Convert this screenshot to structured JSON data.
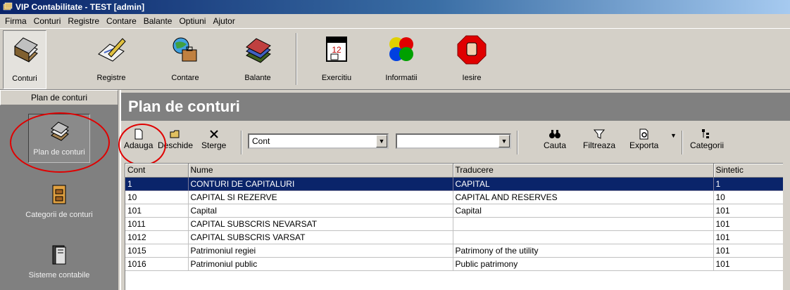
{
  "window": {
    "title": "VIP Contabilitate - TEST [admin]"
  },
  "menu": [
    "Firma",
    "Conturi",
    "Registre",
    "Contare",
    "Balante",
    "Optiuni",
    "Ajutor"
  ],
  "toolbar": {
    "items": [
      {
        "label": "Conturi",
        "icon": "books-icon"
      },
      {
        "label": "Registre",
        "icon": "pencil-icon"
      },
      {
        "label": "Contare",
        "icon": "globe-bag-icon"
      },
      {
        "label": "Balante",
        "icon": "books-stack-icon"
      },
      {
        "label": "Exercitiu",
        "icon": "calendar-icon"
      },
      {
        "label": "Informatii",
        "icon": "colored-circles-icon"
      },
      {
        "label": "Iesire",
        "icon": "stop-hand-icon"
      }
    ]
  },
  "left_panel": {
    "header": "Plan de conturi",
    "items": [
      {
        "label": "Plan de conturi",
        "icon": "books-icon"
      },
      {
        "label": "Categorii de conturi",
        "icon": "archive-icon"
      },
      {
        "label": "Sisteme contabile",
        "icon": "binder-icon"
      }
    ]
  },
  "main": {
    "title": "Plan de conturi",
    "actions": {
      "add": "Adauga",
      "open": "Deschide",
      "delete": "Sterge",
      "search": "Cauta",
      "filter": "Filtreaza",
      "export": "Exporta",
      "categories": "Categorii"
    },
    "field_select": "Cont",
    "value_select": ""
  },
  "table": {
    "columns": [
      "Cont",
      "Nume",
      "Traducere",
      "Sintetic"
    ],
    "rows": [
      [
        "1",
        "CONTURI DE CAPITALURI",
        "CAPITAL",
        "1"
      ],
      [
        "10",
        "CAPITAL SI REZERVE",
        "CAPITAL AND RESERVES",
        "10"
      ],
      [
        "101",
        "Capital",
        "Capital",
        "101"
      ],
      [
        "1011",
        "CAPITAL SUBSCRIS NEVARSAT",
        "",
        "101"
      ],
      [
        "1012",
        "CAPITAL SUBSCRIS VARSAT",
        "",
        "101"
      ],
      [
        "1015",
        "Patrimoniul regiei",
        "Patrimony of the utility",
        "101"
      ],
      [
        "1016",
        "Patrimoniul public",
        "Public patrimony",
        "101"
      ]
    ],
    "selected_row": 0
  },
  "colors": {
    "selection": "#0a246a",
    "highlight_circle": "#e00000",
    "panel": "#808080"
  }
}
